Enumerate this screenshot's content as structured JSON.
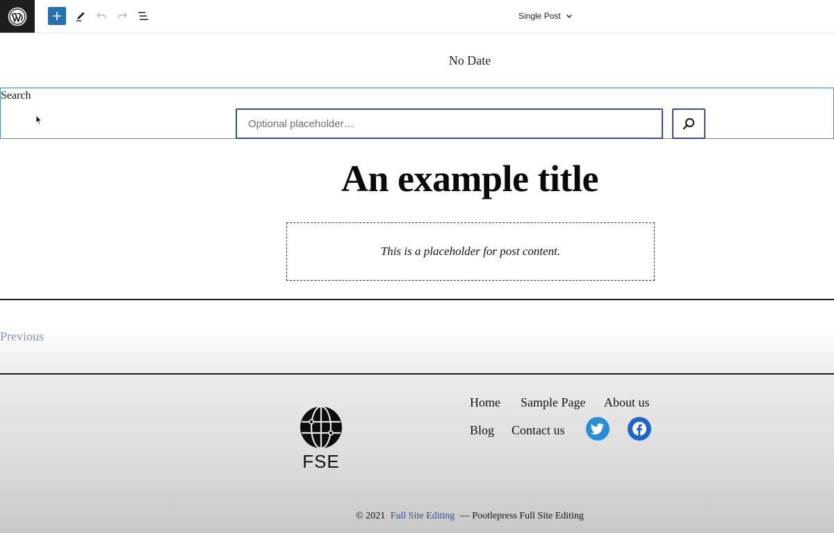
{
  "toolbar": {
    "template_label": "Single Post",
    "icons": {
      "logo": "wordpress-icon",
      "add": "plus-icon",
      "tools": "pencil-icon",
      "undo": "undo-icon",
      "redo": "redo-icon",
      "list_view": "list-view-icon",
      "template_dropdown": "chevron-down-icon"
    },
    "accent_color": "#2271b1"
  },
  "post": {
    "date": "No Date",
    "title": "An example title",
    "content_placeholder": "This is a placeholder for post content."
  },
  "search": {
    "label": "Search",
    "placeholder": "Optional placeholder…",
    "button_icon": "search-icon"
  },
  "navigation": {
    "previous": "Previous"
  },
  "footer": {
    "logo_text": "FSE",
    "menu": [
      {
        "label": "Home"
      },
      {
        "label": "Sample Page"
      },
      {
        "label": "About us"
      },
      {
        "label": "Blog"
      },
      {
        "label": "Contact us"
      }
    ],
    "social": [
      {
        "name": "twitter-icon",
        "color": "#2a8ed6"
      },
      {
        "name": "facebook-icon",
        "color": "#1f66cc"
      }
    ],
    "copyright_prefix": "© 2021",
    "site_name": "Full Site Editing",
    "copyright_suffix": "— Pootlepress Full Site Editing"
  }
}
